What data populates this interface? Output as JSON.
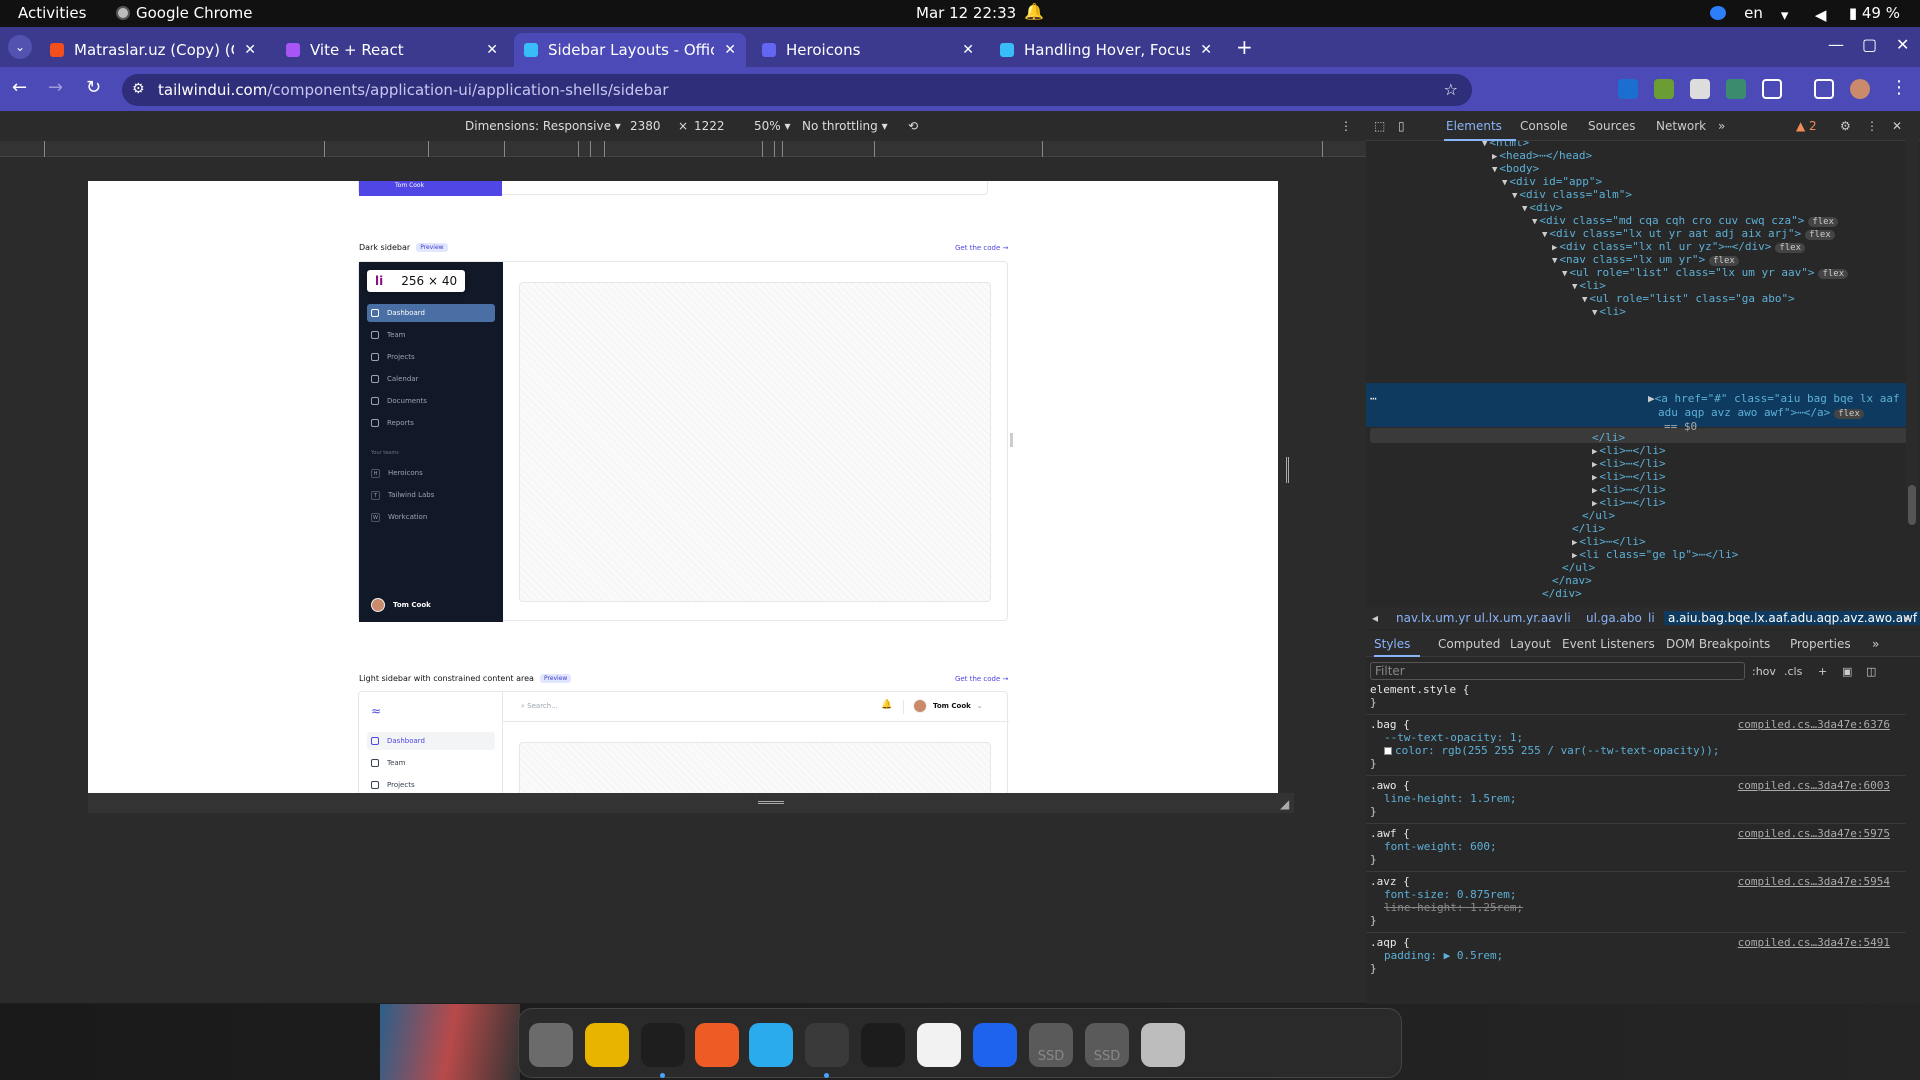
{
  "system_bar": {
    "activities": "Activities",
    "app_name": "Google Chrome",
    "clock": "Mar 12  22:33",
    "language": "en",
    "battery": "49 %"
  },
  "tabs": [
    {
      "title": "Matraslar.uz (Copy) (Cop",
      "color": "#f24e1e"
    },
    {
      "title": "Vite + React",
      "color": "#a855f7"
    },
    {
      "title": "Sidebar Layouts - Officia",
      "color": "#38bdf8",
      "active": true
    },
    {
      "title": "Heroicons",
      "color": "#6366f1"
    },
    {
      "title": "Handling Hover, Focus, a",
      "color": "#38bdf8"
    }
  ],
  "url": {
    "host": "tailwindui.com",
    "path": "/components/application-ui/application-shells/sidebar"
  },
  "device_toolbar": {
    "dimensions_label": "Dimensions: Responsive",
    "width": "2380",
    "times": "×",
    "height": "1222",
    "zoom": "50%",
    "throttling": "No throttling"
  },
  "page": {
    "top_avatar_label": "Tom Cook",
    "section1": {
      "title": "Dark sidebar",
      "badge": "Preview",
      "get_code": "Get the code →",
      "tooltip_tag": "li",
      "tooltip_size": "256 × 40",
      "nav": [
        "Dashboard",
        "Team",
        "Projects",
        "Calendar",
        "Documents",
        "Reports"
      ],
      "teams_heading": "Your teams",
      "teams": [
        {
          "initial": "H",
          "name": "Heroicons"
        },
        {
          "initial": "T",
          "name": "Tailwind Labs"
        },
        {
          "initial": "W",
          "name": "Workcation"
        }
      ],
      "user": "Tom Cook"
    },
    "section2": {
      "title": "Light sidebar with constrained content area",
      "badge": "Preview",
      "get_code": "Get the code →",
      "search_placeholder": "Search...",
      "user": "Tom Cook",
      "nav": [
        "Dashboard",
        "Team",
        "Projects"
      ]
    }
  },
  "devtools": {
    "tabs": [
      "Elements",
      "Console",
      "Sources",
      "Network"
    ],
    "warnings": "2",
    "dom": [
      {
        "indent": 0,
        "open": "▼",
        "html": "<html>"
      },
      {
        "indent": 1,
        "open": "▶",
        "html": "<head>⋯</head>"
      },
      {
        "indent": 1,
        "open": "▼",
        "html": "<body>"
      },
      {
        "indent": 2,
        "open": "▼",
        "html": "<div id=\"app\">"
      },
      {
        "indent": 3,
        "open": "▼",
        "html": "<div class=\"alm\">"
      },
      {
        "indent": 4,
        "open": "▼",
        "html": "<div>"
      },
      {
        "indent": 5,
        "open": "▼",
        "html": "<div class=\"md cqa cqh cro cuv cwq cza\">",
        "flex": true
      },
      {
        "indent": 6,
        "open": "▼",
        "html": "<div class=\"lx ut yr aat adj aix arj\">",
        "flex": true
      },
      {
        "indent": 7,
        "open": "▶",
        "html": "<div class=\"lx nl ur yz\">⋯</div>",
        "flex": true
      },
      {
        "indent": 7,
        "open": "▼",
        "html": "<nav class=\"lx um yr\">",
        "flex": true
      },
      {
        "indent": 8,
        "open": "▼",
        "html": "<ul role=\"list\" class=\"lx um yr aav\">",
        "flex": true
      },
      {
        "indent": 9,
        "open": "▼",
        "html": "<li>"
      },
      {
        "indent": 10,
        "open": "▼",
        "html": "<ul role=\"list\" class=\"ga abo\">"
      },
      {
        "indent": 11,
        "open": "▼",
        "html": "<li>"
      }
    ],
    "selected_line1": "<a href=\"#\" class=\"aiu bag bqe lx aaf",
    "selected_line2": "adu aqp avz awo awf\">⋯</a>",
    "selected_line3": "== $0",
    "dom_after": [
      {
        "indent": 11,
        "open": "",
        "html": "</li>"
      },
      {
        "indent": 11,
        "open": "▶",
        "html": "<li>⋯</li>"
      },
      {
        "indent": 11,
        "open": "▶",
        "html": "<li>⋯</li>"
      },
      {
        "indent": 11,
        "open": "▶",
        "html": "<li>⋯</li>"
      },
      {
        "indent": 11,
        "open": "▶",
        "html": "<li>⋯</li>"
      },
      {
        "indent": 11,
        "open": "▶",
        "html": "<li>⋯</li>"
      },
      {
        "indent": 10,
        "open": "",
        "html": "</ul>"
      },
      {
        "indent": 9,
        "open": "",
        "html": "</li>"
      },
      {
        "indent": 9,
        "open": "▶",
        "html": "<li>⋯</li>"
      },
      {
        "indent": 9,
        "open": "▶",
        "html": "<li class=\"ge lp\">⋯</li>"
      },
      {
        "indent": 8,
        "open": "",
        "html": "</ul>"
      },
      {
        "indent": 7,
        "open": "",
        "html": "</nav>"
      },
      {
        "indent": 6,
        "open": "",
        "html": "</div>"
      }
    ],
    "breadcrumbs": [
      "nav.lx.um.yr",
      "ul.lx.um.yr.aav",
      "li",
      "ul.ga.abo",
      "li",
      "a.aiu.bag.bqe.lx.aaf.adu.aqp.avz.awo.awf"
    ],
    "style_tabs": [
      "Styles",
      "Computed",
      "Layout",
      "Event Listeners",
      "DOM Breakpoints",
      "Properties"
    ],
    "filter_placeholder": "Filter",
    "filter_buttons": [
      ":hov",
      ".cls",
      "+"
    ],
    "rules": [
      {
        "selector": "element.style {",
        "source": "",
        "props": []
      },
      {
        "selector": ".bag {",
        "source": "compiled.cs…3da47e:6376",
        "props": [
          {
            "text": "--tw-text-opacity: 1;",
            "strike": false
          },
          {
            "text": "color: rgb(255 255 255 / var(--tw-text-opacity));",
            "strike": false,
            "swatch": true
          }
        ]
      },
      {
        "selector": ".awo {",
        "source": "compiled.cs…3da47e:6003",
        "props": [
          {
            "text": "line-height: 1.5rem;",
            "strike": false
          }
        ]
      },
      {
        "selector": ".awf {",
        "source": "compiled.cs…3da47e:5975",
        "props": [
          {
            "text": "font-weight: 600;",
            "strike": false
          }
        ]
      },
      {
        "selector": ".avz {",
        "source": "compiled.cs…3da47e:5954",
        "props": [
          {
            "text": "font-size: 0.875rem;",
            "strike": false
          },
          {
            "text": "line-height: 1.25rem;",
            "strike": true
          }
        ]
      },
      {
        "selector": ".aqp {",
        "source": "compiled.cs…3da47e:5491",
        "props": [
          {
            "text": "padding: ▶ 0.5rem;",
            "strike": false
          }
        ]
      }
    ]
  },
  "dock": [
    {
      "name": "files-icon",
      "color": "#6b6b6b"
    },
    {
      "name": "rhythmbox-icon",
      "color": "#e8b400"
    },
    {
      "name": "vscode-icon",
      "color": "#1e1e1e",
      "running": true
    },
    {
      "name": "postman-icon",
      "color": "#ef5b25"
    },
    {
      "name": "telegram-icon",
      "color": "#2aabee"
    },
    {
      "name": "chrome-icon",
      "color": "#3a3a3a",
      "running": true
    },
    {
      "name": "datagrip-icon",
      "color": "#1c1c1c"
    },
    {
      "name": "mongodb-compass-icon",
      "color": "#f2f2f2"
    },
    {
      "name": "docker-icon",
      "color": "#1d63ed"
    },
    {
      "name": "ssd-drive-icon",
      "color": "#5a5a5a",
      "label": "SSD"
    },
    {
      "name": "ssd-drive-icon",
      "color": "#5a5a5a",
      "label": "SSD"
    },
    {
      "name": "trash-icon",
      "color": "#bdbdbd"
    },
    {
      "name": "app-grid-icon",
      "color": "#2a2a2a"
    }
  ]
}
